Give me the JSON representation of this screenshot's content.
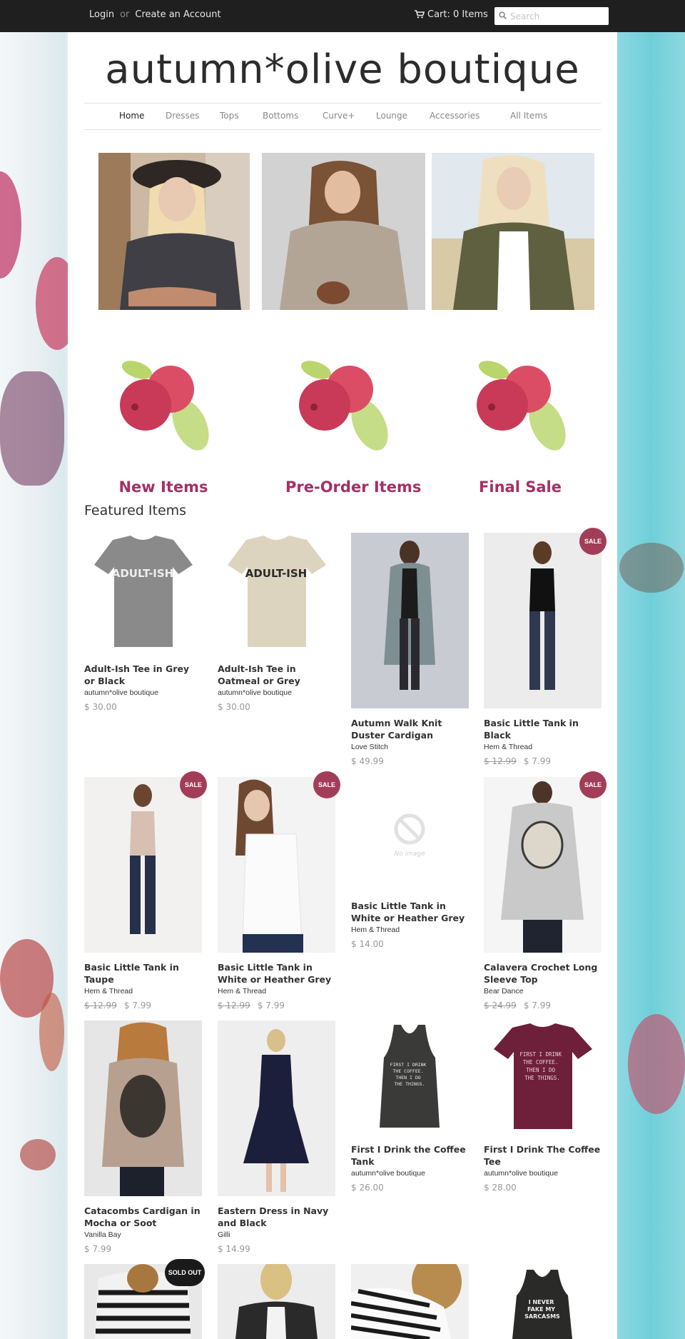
{
  "topbar": {
    "login": "Login",
    "or": "or",
    "create_account": "Create an Account",
    "cart": "Cart: 0 Items",
    "search_placeholder": "Search"
  },
  "store": {
    "name": "autumn*olive boutique"
  },
  "nav": [
    "Home",
    "Dresses",
    "Tops",
    "Bottoms",
    "Curve+",
    "Lounge",
    "Accessories",
    "All Items"
  ],
  "collections": [
    "New Items",
    "Pre-Order Items",
    "Final Sale"
  ],
  "featured_title": "Featured Items",
  "products": [
    {
      "name": "Adult-Ish Tee in Grey or Black",
      "vendor": "autumn*olive boutique",
      "price": "$ 30.00",
      "old_price": ""
    },
    {
      "name": "Adult-Ish Tee in Oatmeal or Grey",
      "vendor": "autumn*olive boutique",
      "price": "$ 30.00",
      "old_price": ""
    },
    {
      "name": "Autumn Walk Knit Duster Cardigan",
      "vendor": "Love Stitch",
      "price": "$ 49.99",
      "old_price": ""
    },
    {
      "name": "Basic Little Tank in Black",
      "vendor": "Hem & Thread",
      "price": "$ 7.99",
      "old_price": "$ 12.99"
    },
    {
      "name": "Basic Little Tank in Taupe",
      "vendor": "Hem & Thread",
      "price": "$ 7.99",
      "old_price": "$ 12.99"
    },
    {
      "name": "Basic Little Tank in White or Heather Grey",
      "vendor": "Hem & Thread",
      "price": "$ 7.99",
      "old_price": "$ 12.99"
    },
    {
      "name": "Basic Little Tank in White or Heather Grey",
      "vendor": "Hem & Thread",
      "price": "$ 14.00",
      "old_price": ""
    },
    {
      "name": "Calavera Crochet Long Sleeve Top",
      "vendor": "Bear Dance",
      "price": "$ 7.99",
      "old_price": "$ 24.99"
    },
    {
      "name": "Catacombs Cardigan in Mocha or Soot",
      "vendor": "Vanilla Bay",
      "price": "$ 7.99",
      "old_price": ""
    },
    {
      "name": "Eastern Dress in Navy and Black",
      "vendor": "Gilli",
      "price": "$ 14.99",
      "old_price": ""
    },
    {
      "name": "First I Drink the Coffee Tank",
      "vendor": "autumn*olive boutique",
      "price": "$ 26.00",
      "old_price": ""
    },
    {
      "name": "First I Drink The Coffee Tee",
      "vendor": "autumn*olive boutique",
      "price": "$ 28.00",
      "old_price": ""
    }
  ],
  "badges": {
    "sale": "SALE",
    "sold_out": "SOLD OUT"
  },
  "product_art": {
    "tee_grey_print": "ADULT-ISH",
    "tee_oatmeal_print": "ADULT-ISH",
    "no_image": "No image",
    "coffee_tank_print": "FIRST I DRINK\nTHE COFFEE.\nTHEN I DO\nTHE THINGS.",
    "coffee_tee_print": "FIRST I DRINK\nTHE COFFEE.\nTHEN I DO\nTHE THINGS.",
    "sarcasm_print": "I NEVER\nFAKE MY\nSARCASMS"
  },
  "colors": {
    "topbar": "#1f1f1f",
    "sale_badge": "#a23d58",
    "collection_label": "#a52f66",
    "berry": "#d9475f",
    "leaf": "#b9d56c"
  }
}
